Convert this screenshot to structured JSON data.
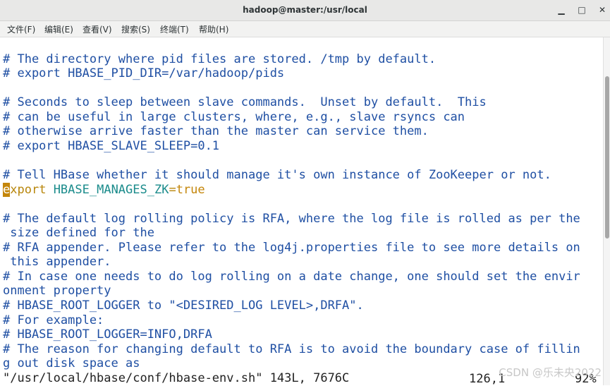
{
  "window": {
    "title": "hadoop@master:/usr/local"
  },
  "menu": [
    "文件(F)",
    "编辑(E)",
    "查看(V)",
    "搜索(S)",
    "终端(T)",
    "帮助(H)"
  ],
  "lines": [
    "# The directory where pid files are stored. /tmp by default.",
    "# export HBASE_PID_DIR=/var/hadoop/pids",
    "",
    "# Seconds to sleep between slave commands.  Unset by default.  This",
    "# can be useful in large clusters, where, e.g., slave rsyncs can",
    "# otherwise arrive faster than the master can service them.",
    "# export HBASE_SLAVE_SLEEP=0.1",
    "",
    "# Tell HBase whether it should manage it's own instance of ZooKeeper or not.",
    "",
    "",
    "# The default log rolling policy is RFA, where the log file is rolled as per the",
    " size defined for the",
    "# RFA appender. Please refer to the log4j.properties file to see more details on",
    " this appender.",
    "# In case one needs to do log rolling on a date change, one should set the envir",
    "onment property",
    "# HBASE_ROOT_LOGGER to \"<DESIRED_LOG LEVEL>,DRFA\".",
    "# For example:",
    "# HBASE_ROOT_LOGGER=INFO,DRFA",
    "# The reason for changing default to RFA is to avoid the boundary case of fillin",
    "g out disk space as"
  ],
  "export_line": {
    "cursor_char": "e",
    "keyword_rest": "xport",
    "variable": "HBASE_MANAGES_ZK",
    "equals": "=",
    "value": "true"
  },
  "status": {
    "file_info": "\"/usr/local/hbase/conf/hbase-env.sh\" 143L, 7676C",
    "position": "126,1",
    "percent": "92%"
  },
  "watermark": "CSDN @乐未央2022",
  "colors": {
    "comment": "#1f4fa3",
    "cursor": "#c4860a",
    "variable": "#1a8b8b"
  }
}
